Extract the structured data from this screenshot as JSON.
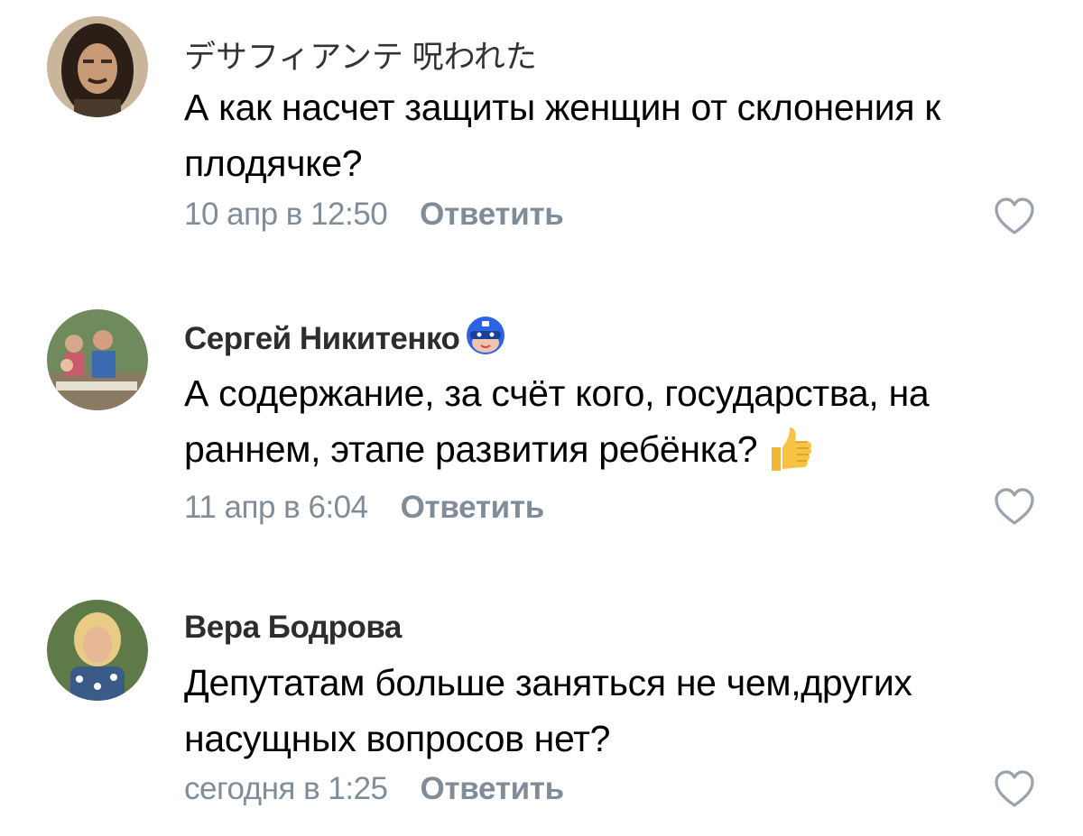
{
  "comments": [
    {
      "author": "デサフィアンテ 呪われた",
      "text": "А как насчет защиты женщин от склонения к плодячке?",
      "time": "10 апр в 12:50",
      "reply_label": "Ответить",
      "avatar_icon": "avatar-long-hair-man"
    },
    {
      "author": "Сергей Никитенко",
      "author_badge_icon": "superhero-mask-badge-icon",
      "text": "А содержание, за счёт кого, государства, на раннем, этапе развития ребёнка?",
      "text_emoji": "thumbs-up-emoji",
      "time": "11 апр в 6:04",
      "reply_label": "Ответить",
      "avatar_icon": "avatar-family-photo"
    },
    {
      "author": "Вера Бодрова",
      "text": "Депутатам больше заняться не чем,других насущных вопросов нет?",
      "time": "сегодня в 1:25",
      "reply_label": "Ответить",
      "avatar_icon": "avatar-blonde-woman"
    }
  ],
  "like_icon": "heart-outline-icon",
  "colors": {
    "text": "#000000",
    "meta": "#818c99",
    "author": "#2c2d2e"
  }
}
